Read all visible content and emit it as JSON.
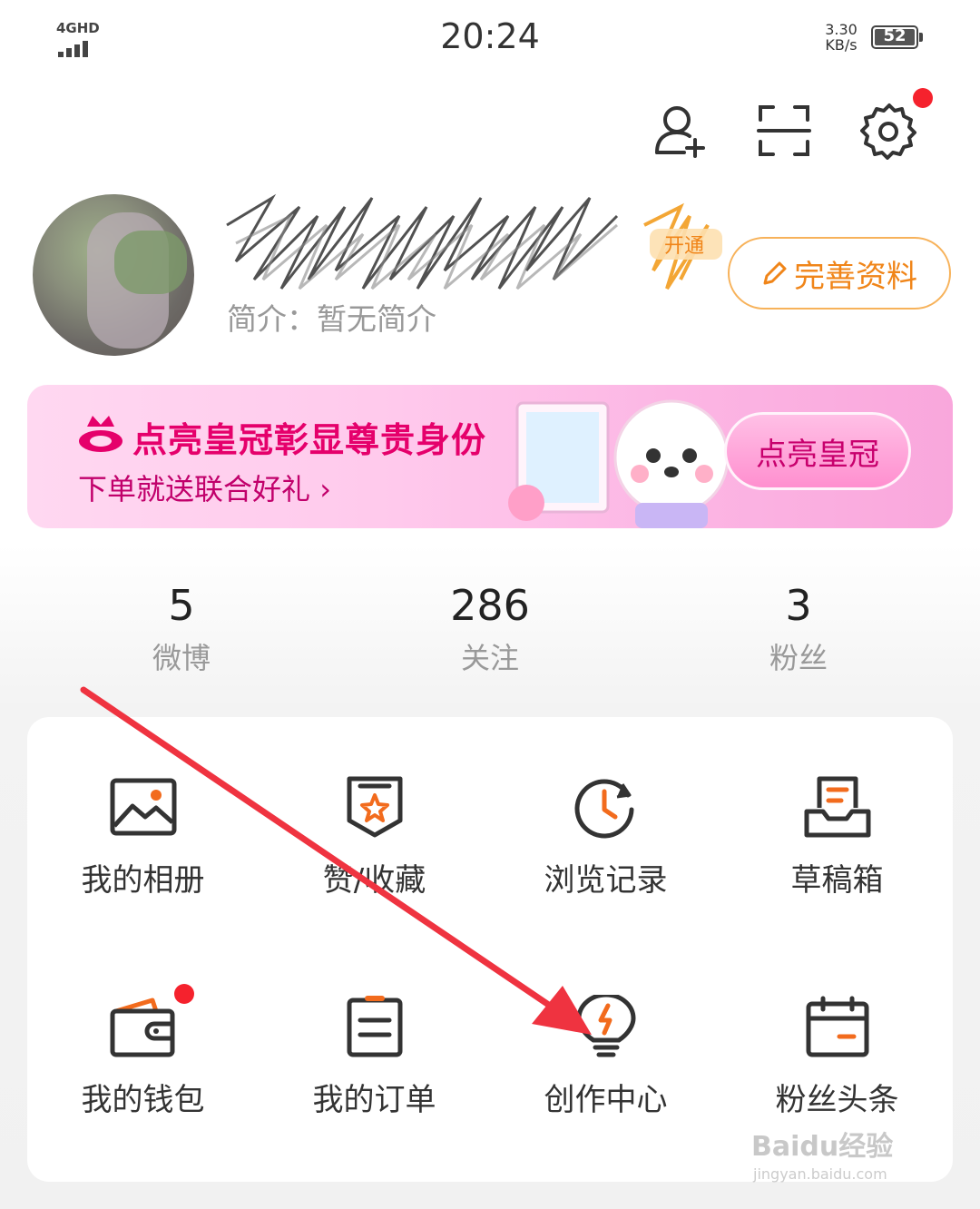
{
  "status_bar": {
    "network": "4GHD",
    "time": "20:24",
    "speed_value": "3.30",
    "speed_unit": "KB/s",
    "battery": "52"
  },
  "header": {
    "icons": [
      "add-friend-icon",
      "scan-icon",
      "settings-icon"
    ]
  },
  "profile": {
    "vip_tag": "开通",
    "bio": "简介：暂无简介",
    "edit_button": "完善资料"
  },
  "banner": {
    "title": "点亮皇冠彰显尊贵身份",
    "subtitle": "下单就送联合好礼",
    "button": "点亮皇冠"
  },
  "stats": [
    {
      "value": "5",
      "label": "微博"
    },
    {
      "value": "286",
      "label": "关注"
    },
    {
      "value": "3",
      "label": "粉丝"
    }
  ],
  "menu": [
    {
      "label": "我的相册",
      "icon": "album-icon"
    },
    {
      "label": "赞/收藏",
      "icon": "favorites-icon"
    },
    {
      "label": "浏览记录",
      "icon": "history-icon"
    },
    {
      "label": "草稿箱",
      "icon": "drafts-icon"
    },
    {
      "label": "我的钱包",
      "icon": "wallet-icon"
    },
    {
      "label": "我的订单",
      "icon": "orders-icon"
    },
    {
      "label": "创作中心",
      "icon": "creator-center-icon"
    },
    {
      "label": "粉丝头条",
      "icon": "fans-headline-icon"
    }
  ],
  "watermark": {
    "brand": "Baidu经验",
    "url": "jingyan.baidu.com"
  },
  "colors": {
    "accent": "#f08519",
    "badge_red": "#f5222d",
    "banner_pink": "#e5006b",
    "annotation_arrow": "#ef3340"
  }
}
